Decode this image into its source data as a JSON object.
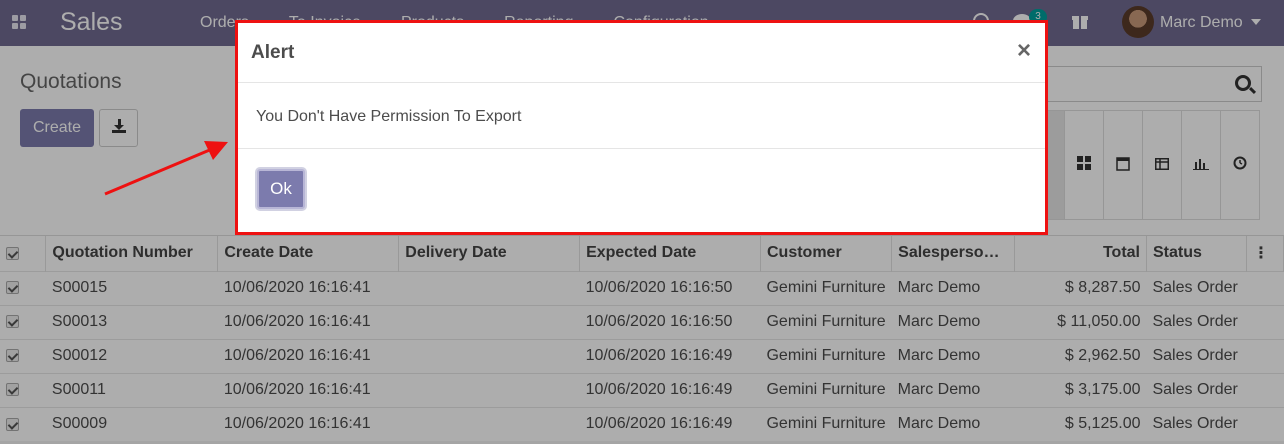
{
  "navbar": {
    "brand": "Sales",
    "menu": [
      "Orders",
      "To Invoice",
      "Products",
      "Reporting",
      "Configuration"
    ],
    "badge_count": "3",
    "user_name": "Marc Demo"
  },
  "control_panel": {
    "breadcrumb": "Quotations",
    "create_label": "Create",
    "export_icon": "download-icon",
    "views": [
      "kanban-icon",
      "calendar-icon",
      "pivot-icon",
      "graph-icon",
      "activity-icon"
    ]
  },
  "table": {
    "columns": [
      "Quotation Number",
      "Create Date",
      "Delivery Date",
      "Expected Date",
      "Customer",
      "Salesperso…",
      "Total",
      "Status"
    ],
    "rows": [
      {
        "number": "S00015",
        "create": "10/06/2020 16:16:41",
        "delivery": "",
        "expected": "10/06/2020 16:16:50",
        "customer": "Gemini Furniture",
        "salesperson": "Marc Demo",
        "total": "$ 8,287.50",
        "status": "Sales Order"
      },
      {
        "number": "S00013",
        "create": "10/06/2020 16:16:41",
        "delivery": "",
        "expected": "10/06/2020 16:16:50",
        "customer": "Gemini Furniture",
        "salesperson": "Marc Demo",
        "total": "$ 11,050.00",
        "status": "Sales Order"
      },
      {
        "number": "S00012",
        "create": "10/06/2020 16:16:41",
        "delivery": "",
        "expected": "10/06/2020 16:16:49",
        "customer": "Gemini Furniture",
        "salesperson": "Marc Demo",
        "total": "$ 2,962.50",
        "status": "Sales Order"
      },
      {
        "number": "S00011",
        "create": "10/06/2020 16:16:41",
        "delivery": "",
        "expected": "10/06/2020 16:16:49",
        "customer": "Gemini Furniture",
        "salesperson": "Marc Demo",
        "total": "$ 3,175.00",
        "status": "Sales Order"
      },
      {
        "number": "S00009",
        "create": "10/06/2020 16:16:41",
        "delivery": "",
        "expected": "10/06/2020 16:16:49",
        "customer": "Gemini Furniture",
        "salesperson": "Marc Demo",
        "total": "$ 5,125.00",
        "status": "Sales Order"
      }
    ]
  },
  "modal": {
    "title": "Alert",
    "close": "×",
    "message": "You Don't Have Permission To Export",
    "ok_label": "Ok"
  },
  "colors": {
    "navbar": "#706a91",
    "primary": "#7c7bad",
    "highlight_border": "#ee1111",
    "arrow": "#ee1111"
  }
}
